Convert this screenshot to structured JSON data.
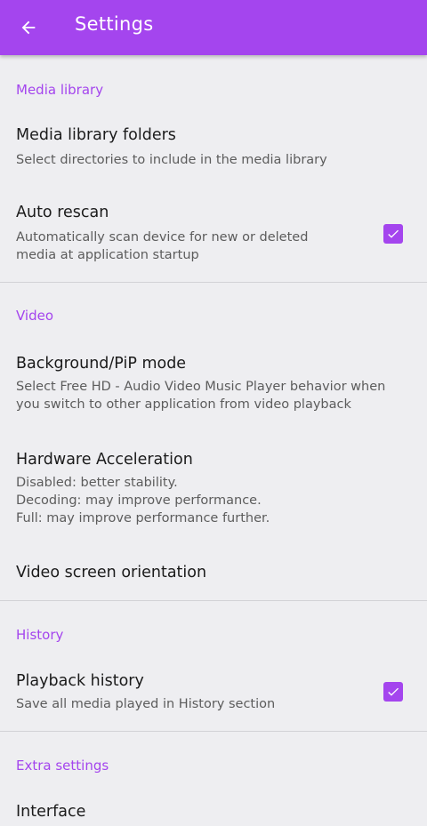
{
  "app_bar": {
    "title": "Settings",
    "back_icon": "arrow-left-icon",
    "color": "#a445ee"
  },
  "sections": {
    "media_library": {
      "header": "Media library",
      "folders": {
        "title": "Media library folders",
        "summary": "Select directories to include in the media library"
      },
      "auto_rescan": {
        "title": "Auto rescan",
        "summary_lines": [
          "Automatically scan device for new or deleted",
          "media at application startup"
        ],
        "checked": true
      }
    },
    "video": {
      "header": "Video",
      "background_pip": {
        "title": "Background/PiP mode",
        "summary_lines": [
          "Select Free HD - Audio Video Music Player behavior when",
          "you switch to other application from video playback"
        ]
      },
      "hw_accel": {
        "title": "Hardware Acceleration",
        "summary_lines": [
          "Disabled: better stability.",
          "Decoding: may improve performance.",
          "Full: may improve performance further."
        ]
      },
      "orientation": {
        "title": "Video screen orientation"
      }
    },
    "history": {
      "header": "History",
      "playback_history": {
        "title": "Playback history",
        "summary": "Save all media played in History section",
        "checked": true
      }
    },
    "extra": {
      "header": "Extra settings",
      "interface": {
        "title": "Interface"
      }
    }
  }
}
